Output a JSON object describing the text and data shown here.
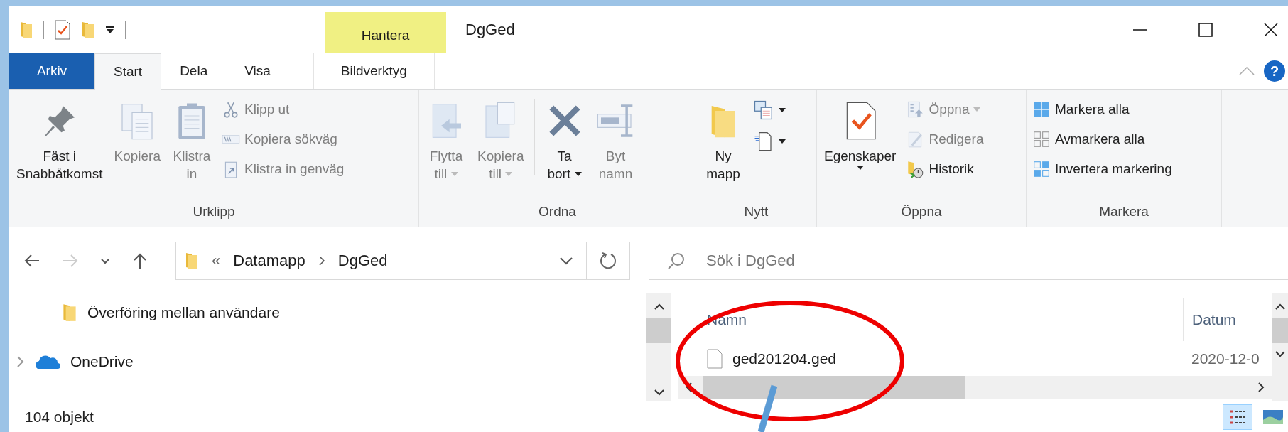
{
  "window": {
    "title": "DgGed",
    "help": "?"
  },
  "context_tab": {
    "header": "Hantera",
    "label": "Bildverktyg",
    "selected": false
  },
  "tabs": [
    {
      "label": "Arkiv",
      "kind": "file",
      "selected": false
    },
    {
      "label": "Start",
      "kind": "tab",
      "selected": true
    },
    {
      "label": "Dela",
      "kind": "tab",
      "selected": false
    },
    {
      "label": "Visa",
      "kind": "tab",
      "selected": false
    }
  ],
  "ribbon": {
    "groups": [
      {
        "label": "Urklipp",
        "items": [
          {
            "kind": "large",
            "lines": [
              "Fäst i",
              "Snabbåtkomst"
            ],
            "disabled": false,
            "dropdown": false
          },
          {
            "kind": "large",
            "lines": [
              "Kopiera"
            ],
            "disabled": true,
            "dropdown": false
          },
          {
            "kind": "large",
            "lines": [
              "Klistra",
              "in"
            ],
            "disabled": true,
            "dropdown": false
          },
          {
            "kind": "small",
            "label": "Klipp ut",
            "disabled": true,
            "dropdown": false
          },
          {
            "kind": "small",
            "label": "Kopiera sökväg",
            "disabled": true,
            "dropdown": false
          },
          {
            "kind": "small",
            "label": "Klistra in genväg",
            "disabled": true,
            "dropdown": false
          }
        ]
      },
      {
        "label": "Ordna",
        "items": [
          {
            "kind": "large",
            "lines": [
              "Flytta",
              "till"
            ],
            "disabled": true,
            "dropdown": true
          },
          {
            "kind": "large",
            "lines": [
              "Kopiera",
              "till"
            ],
            "disabled": true,
            "dropdown": true
          },
          {
            "kind": "separator"
          },
          {
            "kind": "large",
            "lines": [
              "Ta",
              "bort"
            ],
            "disabled": false,
            "dropdown": true
          },
          {
            "kind": "large",
            "lines": [
              "Byt",
              "namn"
            ],
            "disabled": true,
            "dropdown": false
          }
        ]
      },
      {
        "label": "Nytt",
        "items": [
          {
            "kind": "large",
            "lines": [
              "Ny",
              "mapp"
            ],
            "disabled": false,
            "dropdown": false
          },
          {
            "kind": "icon",
            "disabled": false,
            "dropdown": true
          },
          {
            "kind": "icon",
            "disabled": false,
            "dropdown": true
          }
        ]
      },
      {
        "label": "Öppna",
        "items": [
          {
            "kind": "large",
            "lines": [
              "Egenskaper"
            ],
            "disabled": false,
            "dropdown": true
          },
          {
            "kind": "small",
            "label": "Öppna",
            "disabled": true,
            "dropdown": true
          },
          {
            "kind": "small",
            "label": "Redigera",
            "disabled": true,
            "dropdown": false
          },
          {
            "kind": "small",
            "label": "Historik",
            "disabled": false,
            "dropdown": false
          }
        ]
      },
      {
        "label": "Markera",
        "items": [
          {
            "kind": "small",
            "label": "Markera alla",
            "disabled": false,
            "dropdown": false
          },
          {
            "kind": "small",
            "label": "Avmarkera alla",
            "disabled": false,
            "dropdown": false
          },
          {
            "kind": "small",
            "label": "Invertera markering",
            "disabled": false,
            "dropdown": false
          }
        ]
      }
    ]
  },
  "nav_buttons": [
    {
      "kind": "back",
      "disabled": false
    },
    {
      "kind": "forward",
      "disabled": true
    },
    {
      "kind": "recent",
      "disabled": false
    },
    {
      "kind": "up",
      "disabled": false
    }
  ],
  "address": {
    "overflow_mark": "«",
    "segments": [
      "Datamapp",
      "DgGed"
    ]
  },
  "search": {
    "placeholder": "Sök i DgGed"
  },
  "nav_pane": [
    {
      "label": "Överföring mellan användare",
      "kind": "folder",
      "expandable": false
    },
    {
      "label": "OneDrive",
      "kind": "cloud",
      "expandable": true
    }
  ],
  "file_list": {
    "columns": [
      "Namn",
      "Datum"
    ],
    "rows": [
      {
        "name": "ged201204.ged",
        "date": "2020-12-0"
      }
    ]
  },
  "status_bar": {
    "count": "104 objekt"
  },
  "views": [
    {
      "kind": "details",
      "selected": true
    },
    {
      "kind": "large_icons",
      "selected": false
    }
  ]
}
